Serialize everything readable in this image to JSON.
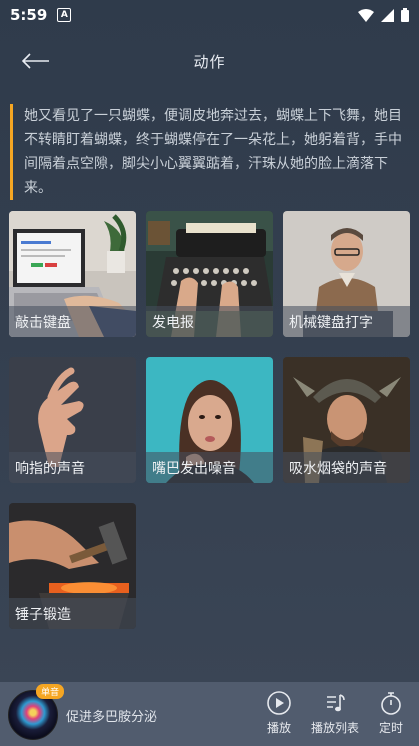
{
  "status": {
    "time": "5:59",
    "app_badge": "A"
  },
  "header": {
    "title": "动作"
  },
  "quote": "她又看见了一只蝴蝶，便调皮地奔过去，蝴蝶上下飞舞，她目不转睛盯着蝴蝶，终于蝴蝶停在了一朵花上，她躬着背，手中间隔着点空隙，脚尖小心翼翼踮着，汗珠从她的脸上滴落下来。",
  "tiles": [
    {
      "label": "敲击键盘"
    },
    {
      "label": "发电报"
    },
    {
      "label": "机械键盘打字"
    },
    {
      "label": "响指的声音"
    },
    {
      "label": "嘴巴发出噪音"
    },
    {
      "label": "吸水烟袋的声音"
    },
    {
      "label": "锤子锻造"
    }
  ],
  "player": {
    "badge": "单音",
    "track": "促进多巴胺分泌",
    "play_label": "播放",
    "playlist_label": "播放列表",
    "timer_label": "定时"
  },
  "colors": {
    "accent": "#f5a623",
    "player_bg": "#515c6e",
    "background": "#333e4e"
  }
}
